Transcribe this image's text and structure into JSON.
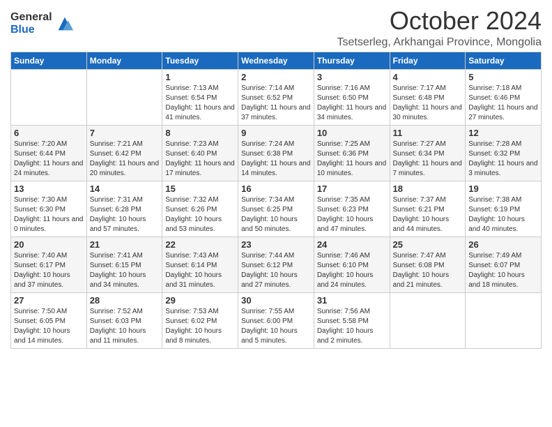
{
  "logo": {
    "general": "General",
    "blue": "Blue"
  },
  "title": "October 2024",
  "subtitle": "Tsetserleg, Arkhangai Province, Mongolia",
  "days_of_week": [
    "Sunday",
    "Monday",
    "Tuesday",
    "Wednesday",
    "Thursday",
    "Friday",
    "Saturday"
  ],
  "weeks": [
    [
      {
        "day": "",
        "sunrise": "",
        "sunset": "",
        "daylight": ""
      },
      {
        "day": "",
        "sunrise": "",
        "sunset": "",
        "daylight": ""
      },
      {
        "day": "1",
        "sunrise": "Sunrise: 7:13 AM",
        "sunset": "Sunset: 6:54 PM",
        "daylight": "Daylight: 11 hours and 41 minutes."
      },
      {
        "day": "2",
        "sunrise": "Sunrise: 7:14 AM",
        "sunset": "Sunset: 6:52 PM",
        "daylight": "Daylight: 11 hours and 37 minutes."
      },
      {
        "day": "3",
        "sunrise": "Sunrise: 7:16 AM",
        "sunset": "Sunset: 6:50 PM",
        "daylight": "Daylight: 11 hours and 34 minutes."
      },
      {
        "day": "4",
        "sunrise": "Sunrise: 7:17 AM",
        "sunset": "Sunset: 6:48 PM",
        "daylight": "Daylight: 11 hours and 30 minutes."
      },
      {
        "day": "5",
        "sunrise": "Sunrise: 7:18 AM",
        "sunset": "Sunset: 6:46 PM",
        "daylight": "Daylight: 11 hours and 27 minutes."
      }
    ],
    [
      {
        "day": "6",
        "sunrise": "Sunrise: 7:20 AM",
        "sunset": "Sunset: 6:44 PM",
        "daylight": "Daylight: 11 hours and 24 minutes."
      },
      {
        "day": "7",
        "sunrise": "Sunrise: 7:21 AM",
        "sunset": "Sunset: 6:42 PM",
        "daylight": "Daylight: 11 hours and 20 minutes."
      },
      {
        "day": "8",
        "sunrise": "Sunrise: 7:23 AM",
        "sunset": "Sunset: 6:40 PM",
        "daylight": "Daylight: 11 hours and 17 minutes."
      },
      {
        "day": "9",
        "sunrise": "Sunrise: 7:24 AM",
        "sunset": "Sunset: 6:38 PM",
        "daylight": "Daylight: 11 hours and 14 minutes."
      },
      {
        "day": "10",
        "sunrise": "Sunrise: 7:25 AM",
        "sunset": "Sunset: 6:36 PM",
        "daylight": "Daylight: 11 hours and 10 minutes."
      },
      {
        "day": "11",
        "sunrise": "Sunrise: 7:27 AM",
        "sunset": "Sunset: 6:34 PM",
        "daylight": "Daylight: 11 hours and 7 minutes."
      },
      {
        "day": "12",
        "sunrise": "Sunrise: 7:28 AM",
        "sunset": "Sunset: 6:32 PM",
        "daylight": "Daylight: 11 hours and 3 minutes."
      }
    ],
    [
      {
        "day": "13",
        "sunrise": "Sunrise: 7:30 AM",
        "sunset": "Sunset: 6:30 PM",
        "daylight": "Daylight: 11 hours and 0 minutes."
      },
      {
        "day": "14",
        "sunrise": "Sunrise: 7:31 AM",
        "sunset": "Sunset: 6:28 PM",
        "daylight": "Daylight: 10 hours and 57 minutes."
      },
      {
        "day": "15",
        "sunrise": "Sunrise: 7:32 AM",
        "sunset": "Sunset: 6:26 PM",
        "daylight": "Daylight: 10 hours and 53 minutes."
      },
      {
        "day": "16",
        "sunrise": "Sunrise: 7:34 AM",
        "sunset": "Sunset: 6:25 PM",
        "daylight": "Daylight: 10 hours and 50 minutes."
      },
      {
        "day": "17",
        "sunrise": "Sunrise: 7:35 AM",
        "sunset": "Sunset: 6:23 PM",
        "daylight": "Daylight: 10 hours and 47 minutes."
      },
      {
        "day": "18",
        "sunrise": "Sunrise: 7:37 AM",
        "sunset": "Sunset: 6:21 PM",
        "daylight": "Daylight: 10 hours and 44 minutes."
      },
      {
        "day": "19",
        "sunrise": "Sunrise: 7:38 AM",
        "sunset": "Sunset: 6:19 PM",
        "daylight": "Daylight: 10 hours and 40 minutes."
      }
    ],
    [
      {
        "day": "20",
        "sunrise": "Sunrise: 7:40 AM",
        "sunset": "Sunset: 6:17 PM",
        "daylight": "Daylight: 10 hours and 37 minutes."
      },
      {
        "day": "21",
        "sunrise": "Sunrise: 7:41 AM",
        "sunset": "Sunset: 6:15 PM",
        "daylight": "Daylight: 10 hours and 34 minutes."
      },
      {
        "day": "22",
        "sunrise": "Sunrise: 7:43 AM",
        "sunset": "Sunset: 6:14 PM",
        "daylight": "Daylight: 10 hours and 31 minutes."
      },
      {
        "day": "23",
        "sunrise": "Sunrise: 7:44 AM",
        "sunset": "Sunset: 6:12 PM",
        "daylight": "Daylight: 10 hours and 27 minutes."
      },
      {
        "day": "24",
        "sunrise": "Sunrise: 7:46 AM",
        "sunset": "Sunset: 6:10 PM",
        "daylight": "Daylight: 10 hours and 24 minutes."
      },
      {
        "day": "25",
        "sunrise": "Sunrise: 7:47 AM",
        "sunset": "Sunset: 6:08 PM",
        "daylight": "Daylight: 10 hours and 21 minutes."
      },
      {
        "day": "26",
        "sunrise": "Sunrise: 7:49 AM",
        "sunset": "Sunset: 6:07 PM",
        "daylight": "Daylight: 10 hours and 18 minutes."
      }
    ],
    [
      {
        "day": "27",
        "sunrise": "Sunrise: 7:50 AM",
        "sunset": "Sunset: 6:05 PM",
        "daylight": "Daylight: 10 hours and 14 minutes."
      },
      {
        "day": "28",
        "sunrise": "Sunrise: 7:52 AM",
        "sunset": "Sunset: 6:03 PM",
        "daylight": "Daylight: 10 hours and 11 minutes."
      },
      {
        "day": "29",
        "sunrise": "Sunrise: 7:53 AM",
        "sunset": "Sunset: 6:02 PM",
        "daylight": "Daylight: 10 hours and 8 minutes."
      },
      {
        "day": "30",
        "sunrise": "Sunrise: 7:55 AM",
        "sunset": "Sunset: 6:00 PM",
        "daylight": "Daylight: 10 hours and 5 minutes."
      },
      {
        "day": "31",
        "sunrise": "Sunrise: 7:56 AM",
        "sunset": "Sunset: 5:58 PM",
        "daylight": "Daylight: 10 hours and 2 minutes."
      },
      {
        "day": "",
        "sunrise": "",
        "sunset": "",
        "daylight": ""
      },
      {
        "day": "",
        "sunrise": "",
        "sunset": "",
        "daylight": ""
      }
    ]
  ]
}
